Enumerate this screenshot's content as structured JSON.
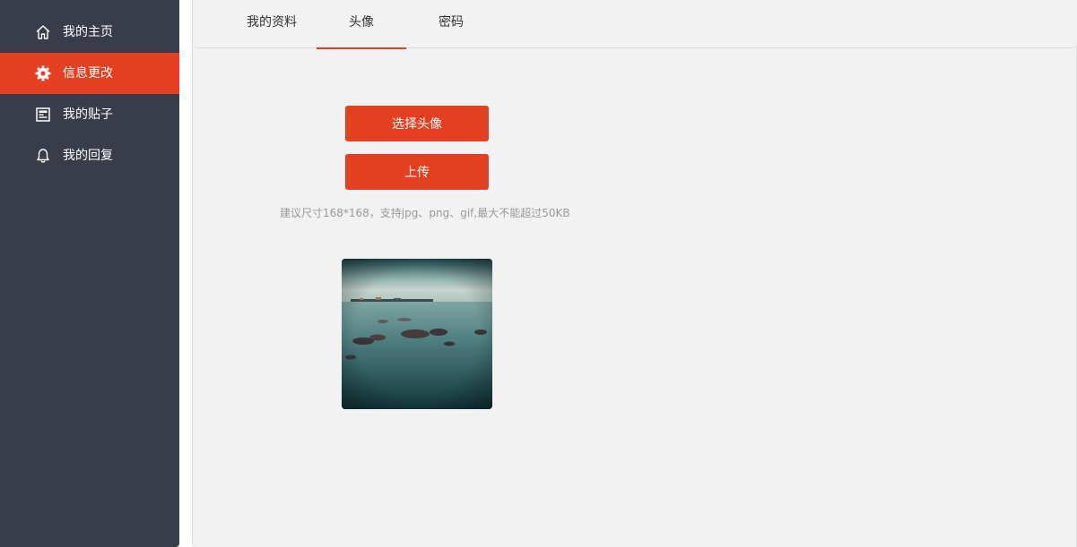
{
  "sidebar": {
    "items": [
      {
        "label": "我的主页",
        "icon": "home-icon",
        "active": false
      },
      {
        "label": "信息更改",
        "icon": "gear-icon",
        "active": true
      },
      {
        "label": "我的贴子",
        "icon": "post-icon",
        "active": false
      },
      {
        "label": "我的回复",
        "icon": "bell-icon",
        "active": false
      }
    ]
  },
  "tabs": [
    {
      "label": "我的资料",
      "active": false
    },
    {
      "label": "头像",
      "active": true
    },
    {
      "label": "密码",
      "active": false
    }
  ],
  "avatar": {
    "choose_label": "选择头像",
    "upload_label": "上传",
    "hint": "建议尺寸168*168，支持jpg、png、gif,最大不能超过50KB"
  },
  "colors": {
    "sidebar_bg": "#393d49",
    "accent": "#e43f21",
    "main_bg": "#f2f2f2",
    "hint_text": "#999999"
  }
}
